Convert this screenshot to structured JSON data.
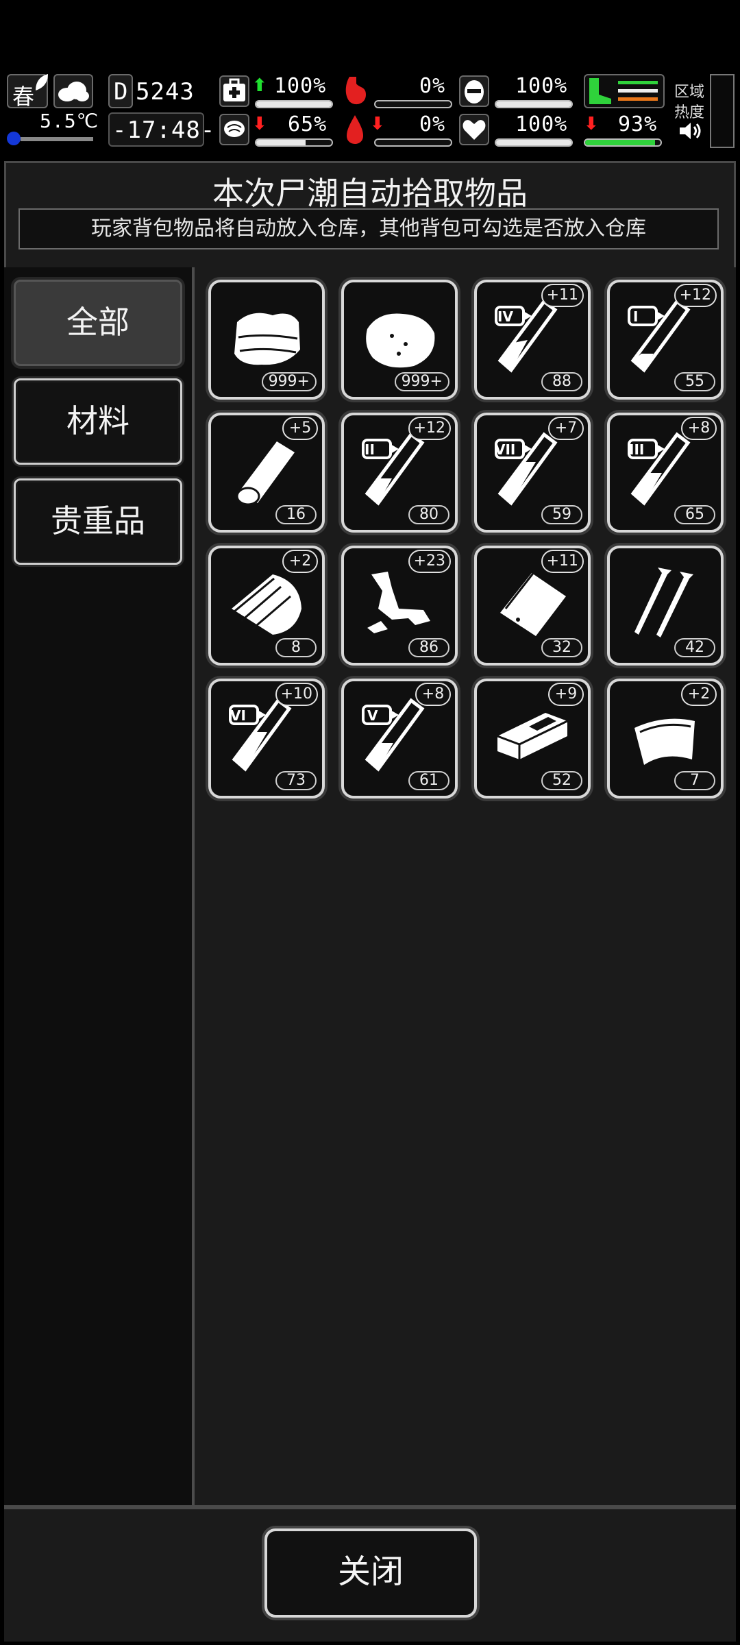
{
  "hud": {
    "season": "春",
    "temperature": "5.5℃",
    "day": "5243",
    "time": "-17:48-",
    "stats": [
      {
        "name": "health",
        "value": "100%",
        "trend": "up",
        "level": 1.0
      },
      {
        "name": "hunger",
        "value": "0%",
        "trend": "",
        "level": 0.0
      },
      {
        "name": "thirst-armor",
        "value": "100%",
        "trend": "",
        "level": 1.0
      },
      {
        "name": "sanity",
        "value": "65%",
        "trend": "down",
        "level": 0.65
      },
      {
        "name": "blood",
        "value": "0%",
        "trend": "down",
        "level": 0.0
      },
      {
        "name": "mood",
        "value": "100%",
        "trend": "",
        "level": 1.0
      },
      {
        "name": "stamina",
        "value": "93%",
        "trend": "down",
        "level": 0.93
      }
    ],
    "zone_heat_label_1": "区域",
    "zone_heat_label_2": "热度"
  },
  "window": {
    "title": "本次尸潮自动拾取物品",
    "subtitle": "玩家背包物品将自动放入仓库，其他背包可勾选是否放入仓库"
  },
  "categories": [
    {
      "label": "全部",
      "active": true
    },
    {
      "label": "材料",
      "active": false
    },
    {
      "label": "贵重品",
      "active": false
    }
  ],
  "items": [
    {
      "icon": "cloth-icon",
      "count": "999+",
      "plus": ""
    },
    {
      "icon": "meat-icon",
      "count": "999+",
      "plus": ""
    },
    {
      "icon": "syringe-iv-icon",
      "count": "88",
      "plus": "+11",
      "tier": "IV"
    },
    {
      "icon": "syringe-i-icon",
      "count": "55",
      "plus": "+12",
      "tier": "I"
    },
    {
      "icon": "wood-log-icon",
      "count": "16",
      "plus": "+5"
    },
    {
      "icon": "syringe-ii-icon",
      "count": "80",
      "plus": "+12",
      "tier": "II"
    },
    {
      "icon": "syringe-vii-icon",
      "count": "59",
      "plus": "+7",
      "tier": "VII"
    },
    {
      "icon": "syringe-iii-icon",
      "count": "65",
      "plus": "+8",
      "tier": "III"
    },
    {
      "icon": "wood-plank-icon",
      "count": "8",
      "plus": "+2"
    },
    {
      "icon": "scrap-metal-icon",
      "count": "86",
      "plus": "+23"
    },
    {
      "icon": "plastic-bag-icon",
      "count": "32",
      "plus": "+11"
    },
    {
      "icon": "nails-icon",
      "count": "42",
      "plus": ""
    },
    {
      "icon": "syringe-vi-icon",
      "count": "73",
      "plus": "+10",
      "tier": "VI"
    },
    {
      "icon": "syringe-v-icon",
      "count": "61",
      "plus": "+8",
      "tier": "V"
    },
    {
      "icon": "brick-icon",
      "count": "52",
      "plus": "+9"
    },
    {
      "icon": "leather-icon",
      "count": "7",
      "plus": "+2"
    }
  ],
  "footer": {
    "close_label": "关闭"
  }
}
